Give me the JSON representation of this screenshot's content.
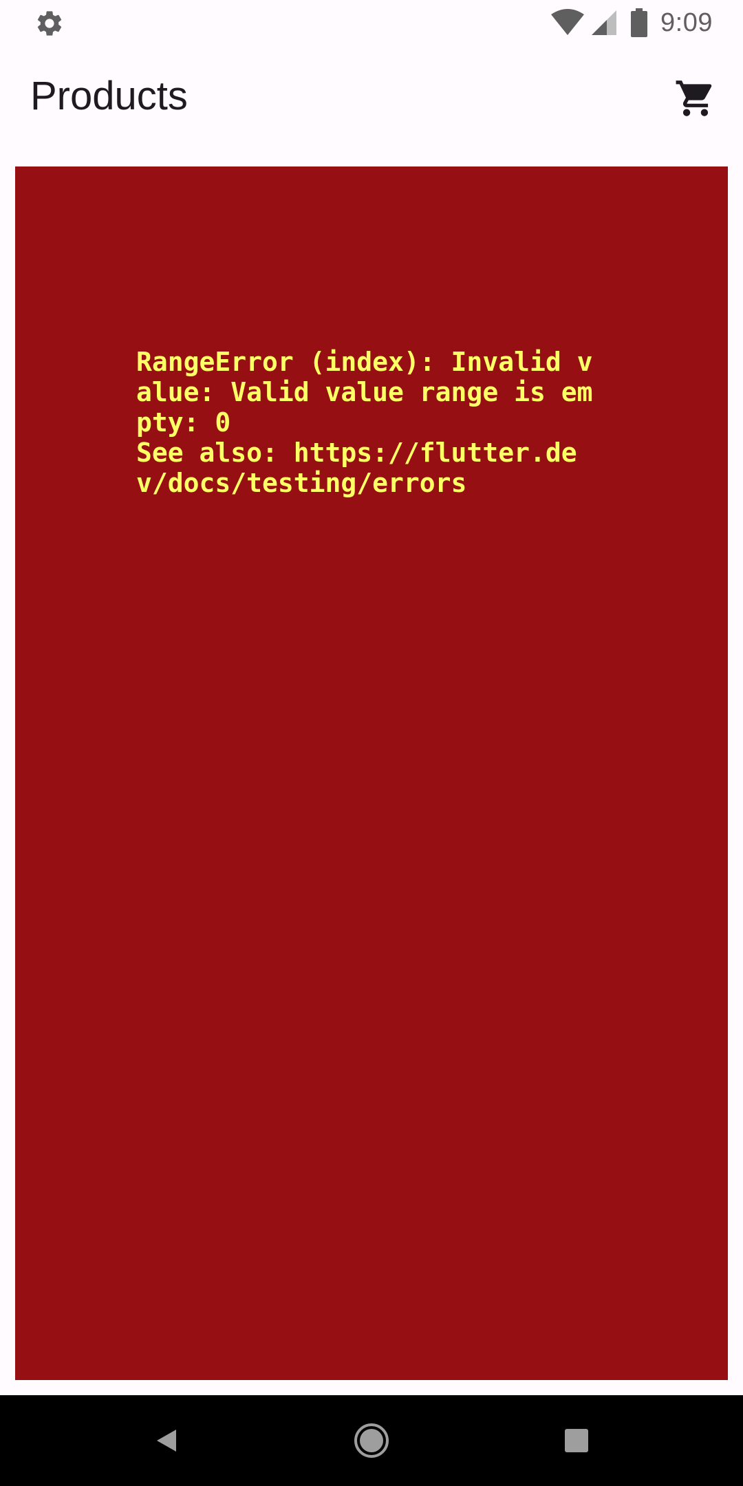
{
  "status_bar": {
    "time": "9:09",
    "icons": [
      "settings-icon",
      "wifi-icon",
      "signal-icon",
      "battery-icon"
    ]
  },
  "app_bar": {
    "title": "Products",
    "action_icon": "cart-icon"
  },
  "error": {
    "message": "RangeError (index): Invalid value: Valid value range is empty: 0\nSee also: https://flutter.dev/docs/testing/errors",
    "background_color": "#960f12",
    "text_color": "#ffff66"
  },
  "nav_bar": {
    "buttons": [
      "back-icon",
      "home-icon",
      "recents-icon"
    ]
  }
}
